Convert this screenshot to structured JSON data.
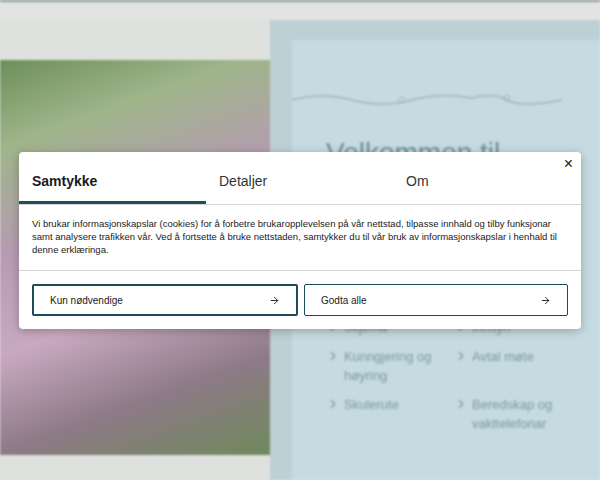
{
  "page": {
    "heading": "Velkommen til",
    "links": [
      {
        "label": "Skjema"
      },
      {
        "label": "Innsyn"
      },
      {
        "label": "Kunngjering og høyring"
      },
      {
        "label": "Avtal møte"
      },
      {
        "label": "Skulerute"
      },
      {
        "label": "Beredskap og vakttelefonar"
      }
    ]
  },
  "dialog": {
    "close": "×",
    "tabs": [
      {
        "label": "Samtykke",
        "selected": true
      },
      {
        "label": "Detaljer",
        "selected": false
      },
      {
        "label": "Om",
        "selected": false
      }
    ],
    "text": "Vi brukar informasjonskapslar (cookies) for å forbetre brukaropplevelsen på vår nettstad, tilpasse innhald og tilby funksjonar samt analysere trafikken vår. Ved å fortsette å bruke nettstaden, samtykker du til vår bruk av informasjonskapslar i henhald til denne erklæringa.",
    "buttons": [
      {
        "label": "Kun nødvendige",
        "focused": true
      },
      {
        "label": "Godta alle",
        "focused": false
      }
    ]
  }
}
